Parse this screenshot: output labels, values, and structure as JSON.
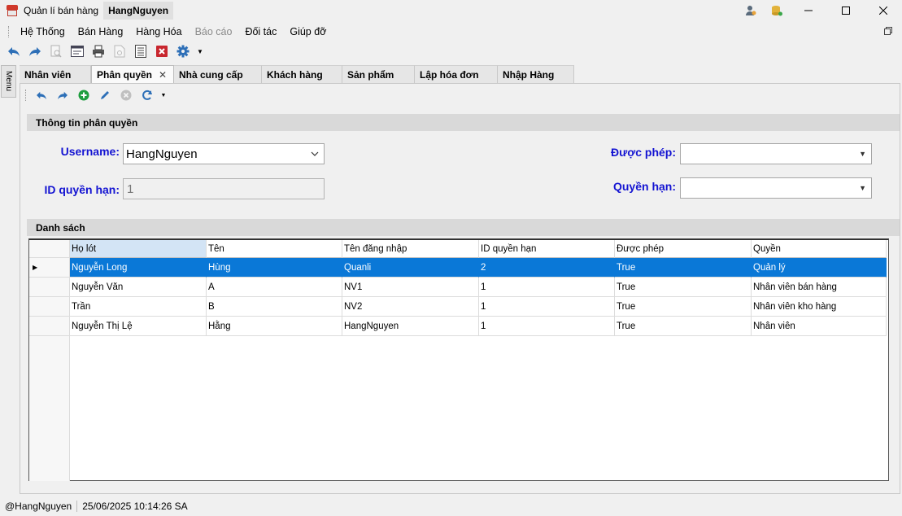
{
  "window": {
    "app_title": "Quản lí bán hàng",
    "user_tab": "HangNguyen"
  },
  "menu": {
    "items": [
      {
        "label": "Hệ Thống",
        "enabled": true
      },
      {
        "label": "Bán Hàng",
        "enabled": true
      },
      {
        "label": "Hàng Hóa",
        "enabled": true
      },
      {
        "label": "Báo cáo",
        "enabled": false
      },
      {
        "label": "Đối tác",
        "enabled": true
      },
      {
        "label": "Giúp đỡ",
        "enabled": true
      }
    ]
  },
  "side_tab": {
    "label": "Menu"
  },
  "tabs": [
    {
      "label": "Nhân viên",
      "active": false
    },
    {
      "label": "Phân quyền",
      "active": true
    },
    {
      "label": "Nhà cung cấp",
      "active": false
    },
    {
      "label": "Khách hàng",
      "active": false
    },
    {
      "label": "Sản phẩm",
      "active": false
    },
    {
      "label": "Lập hóa đơn",
      "active": false
    },
    {
      "label": "Nhập Hàng",
      "active": false
    }
  ],
  "info_section": {
    "title": "Thông tin phân quyền",
    "username_label": "Username:",
    "username_value": "HangNguyen",
    "id_label": "ID quyền hạn:",
    "id_value": "1",
    "allowed_label": "Được phép:",
    "allowed_value": "",
    "permission_label": "Quyền hạn:",
    "permission_value": ""
  },
  "list_section": {
    "title": "Danh sách",
    "columns": [
      "Họ lót",
      "Tên",
      "Tên đăng nhập",
      "ID quyền hạn",
      "Được phép",
      "Quyền"
    ],
    "rows": [
      [
        "Nguyễn Long",
        "Hùng",
        "Quanli",
        "2",
        "True",
        "Quản lý"
      ],
      [
        "Nguyễn Văn",
        "A",
        "NV1",
        "1",
        "True",
        "Nhân viên bán hàng"
      ],
      [
        "Trần",
        "B",
        "NV2",
        "1",
        "True",
        "Nhân viên kho hàng"
      ],
      [
        "Nguyễn Thị Lệ",
        "Hằng",
        "HangNguyen",
        "1",
        "True",
        "Nhân viên"
      ]
    ],
    "selected_row": 0
  },
  "status": {
    "user": "@HangNguyen",
    "datetime": "25/06/2025 10:14:26 SA"
  },
  "colors": {
    "label_blue": "#1414d2",
    "selection": "#0a78d7",
    "section_header": "#d9d9d9"
  }
}
